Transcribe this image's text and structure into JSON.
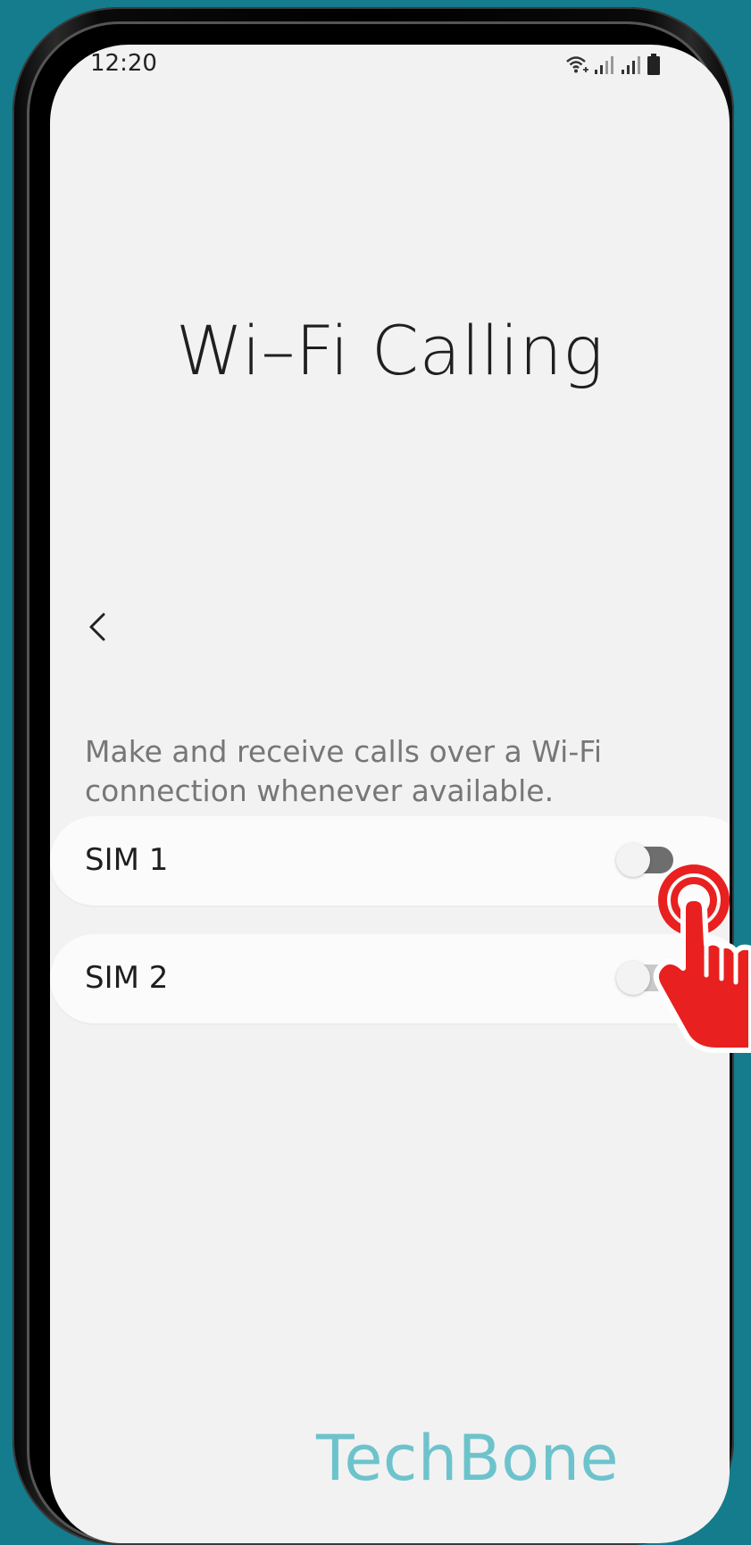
{
  "status_bar": {
    "time": "12:20",
    "icons": [
      "wifi-calling-icon",
      "signal-sim1-icon",
      "signal-sim2-icon",
      "battery-icon"
    ]
  },
  "page": {
    "title": "Wi–Fi Calling",
    "back_icon": "chevron-left-icon",
    "description": "Make and receive calls over a Wi-Fi connection whenever available."
  },
  "settings": [
    {
      "label": "SIM 1",
      "enabled": false
    },
    {
      "label": "SIM 2",
      "enabled": false
    }
  ],
  "overlay": {
    "watermark": "TechBone",
    "hand_icon": "tap-hand-icon",
    "accent_color": "#e8201f"
  },
  "colors": {
    "background": "#147c8c",
    "screen": "#f2f2f2",
    "watermark": "#6dc3cc"
  }
}
